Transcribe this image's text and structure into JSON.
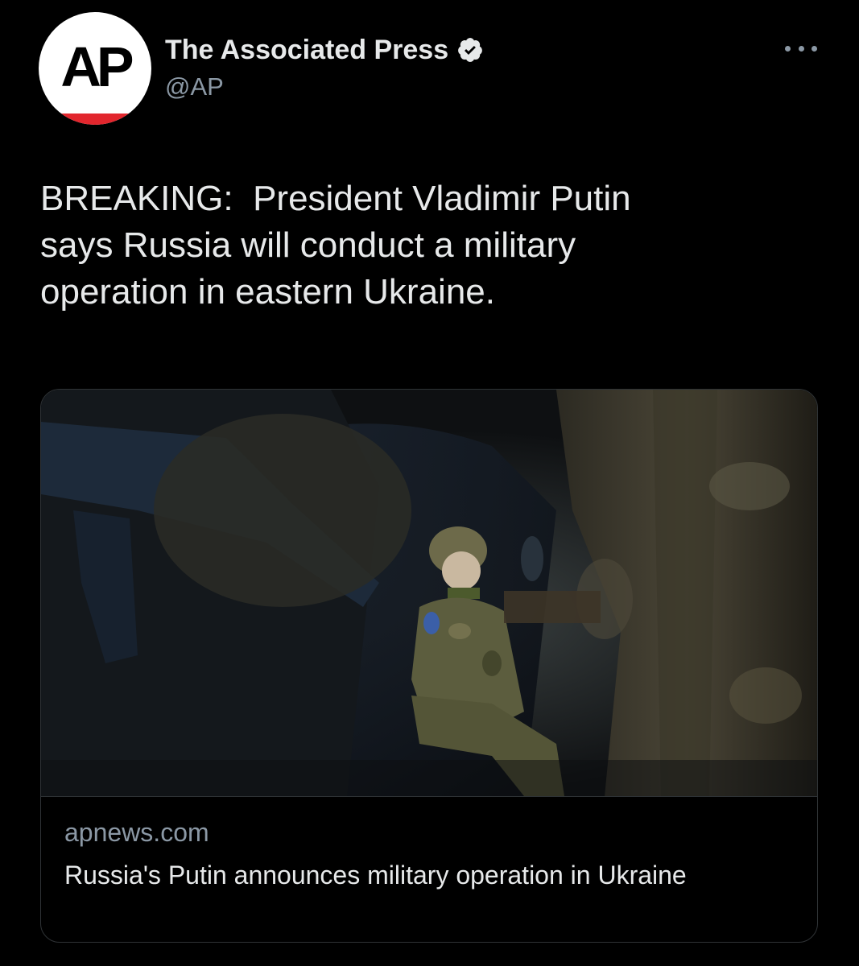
{
  "account": {
    "avatar_text": "AP",
    "display_name": "The Associated Press",
    "handle": "@AP",
    "verified_icon": "verified-badge-icon"
  },
  "menu": {
    "more_icon": "more-options-icon"
  },
  "tweet": {
    "text": "BREAKING:  President Vladimir Putin\nsays Russia will conduct a military\noperation in eastern Ukraine."
  },
  "card": {
    "image_subject": "soldier-photo",
    "domain": "apnews.com",
    "title": "Russia's Putin announces military operation in Ukraine"
  },
  "colors": {
    "background": "#000000",
    "text_primary": "#e7e9ea",
    "text_secondary": "#8b98a5",
    "border": "#2f3336",
    "ap_red": "#e2262d"
  }
}
